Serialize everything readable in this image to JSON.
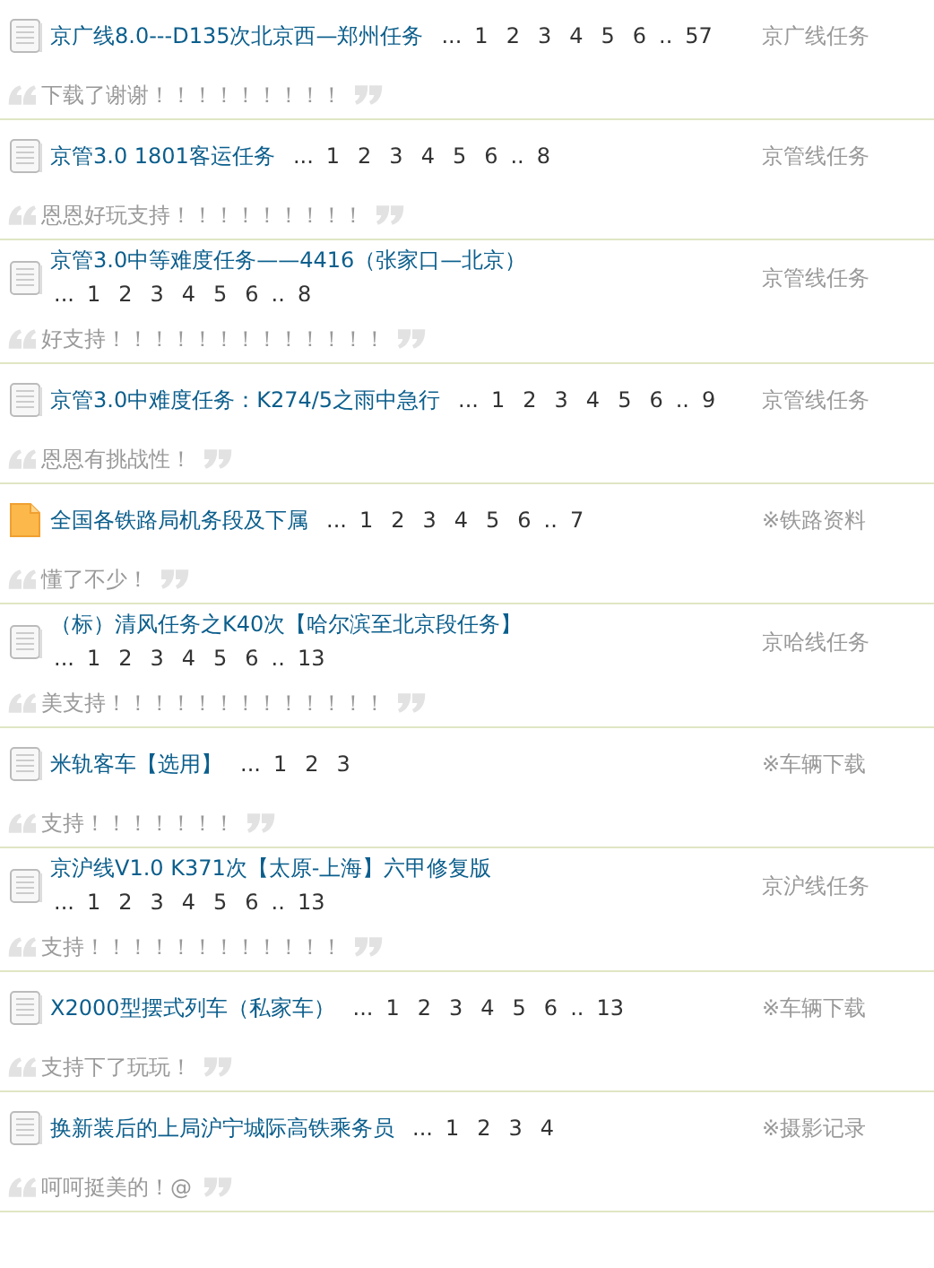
{
  "threads": [
    {
      "kind": "document",
      "title": "京广线8.0---D135次北京西—郑州任务",
      "pages": [
        "...",
        "1",
        "2",
        "3",
        "4",
        "5",
        "6",
        "..",
        "57"
      ],
      "category": "京广线任务",
      "comment": "下载了谢谢！！！！！！！！！"
    },
    {
      "kind": "document",
      "title": "京管3.0 1801客运任务",
      "pages": [
        "...",
        "1",
        "2",
        "3",
        "4",
        "5",
        "6",
        "..",
        "8"
      ],
      "category": "京管线任务",
      "comment": "恩恩好玩支持！！！！！！！！！"
    },
    {
      "kind": "document",
      "title": "京管3.0中等难度任务——4416（张家口—北京）",
      "pages": [
        "...",
        "1",
        "2",
        "3",
        "4",
        "5",
        "6",
        "..",
        "8"
      ],
      "category": "京管线任务",
      "comment": "好支持！！！！！！！！！！！！！"
    },
    {
      "kind": "document",
      "title": "京管3.0中难度任务：K274/5之雨中急行",
      "pages": [
        "...",
        "1",
        "2",
        "3",
        "4",
        "5",
        "6",
        "..",
        "9"
      ],
      "category": "京管线任务",
      "comment": "恩恩有挑战性！"
    },
    {
      "kind": "folder",
      "title": "全国各铁路局机务段及下属",
      "pages": [
        "...",
        "1",
        "2",
        "3",
        "4",
        "5",
        "6",
        "..",
        "7"
      ],
      "category": "※铁路资料",
      "comment": "懂了不少！"
    },
    {
      "kind": "document",
      "title": "（标）清风任务之K40次【哈尔滨至北京段任务】",
      "pages": [
        "...",
        "1",
        "2",
        "3",
        "4",
        "5",
        "6",
        "..",
        "13"
      ],
      "category": "京哈线任务",
      "comment": "美支持！！！！！！！！！！！！！"
    },
    {
      "kind": "document",
      "title": "米轨客车【选用】",
      "pages": [
        "...",
        "1",
        "2",
        "3"
      ],
      "category": "※车辆下载",
      "comment": "支持！！！！！！！"
    },
    {
      "kind": "document",
      "title": "京沪线V1.0 K371次【太原-上海】六甲修复版",
      "pages": [
        "...",
        "1",
        "2",
        "3",
        "4",
        "5",
        "6",
        "..",
        "13"
      ],
      "category": "京沪线任务",
      "comment": "支持！！！！！！！！！！！！"
    },
    {
      "kind": "document",
      "title": "X2000型摆式列车（私家车）",
      "pages": [
        "...",
        "1",
        "2",
        "3",
        "4",
        "5",
        "6",
        "..",
        "13"
      ],
      "category": "※车辆下载",
      "comment": "支持下了玩玩！"
    },
    {
      "kind": "document",
      "title": "换新装后的上局沪宁城际高铁乘务员",
      "pages": [
        "...",
        "1",
        "2",
        "3",
        "4"
      ],
      "category": "※摄影记录",
      "comment": "呵呵挺美的！@"
    }
  ]
}
